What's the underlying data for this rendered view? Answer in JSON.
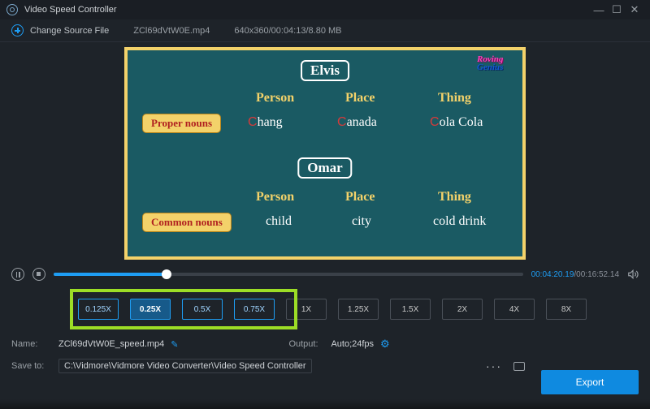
{
  "app": {
    "title": "Video Speed Controller"
  },
  "toolbar": {
    "change_source": "Change Source File",
    "filename": "ZCl69dVtW0E.mp4",
    "meta": "640x360/00:04:13/8.80 MB"
  },
  "preview": {
    "logo": {
      "line1": "Roving",
      "line2": "Genius"
    },
    "name1": "Elvis",
    "name2": "Omar",
    "headers": {
      "person": "Person",
      "place": "Place",
      "thing": "Thing"
    },
    "pill1": "Proper nouns",
    "pill2": "Common nouns",
    "row1": {
      "person": "Chang",
      "place": "Canada",
      "thing": "Cola Cola",
      "p_i": "C",
      "pl_i": "C",
      "t_i": "C"
    },
    "row2": {
      "person": "child",
      "place": "city",
      "thing": "cold drink"
    }
  },
  "transport": {
    "current": "00:04:20.19",
    "total": "00:16:52.14"
  },
  "speeds": [
    "0.125X",
    "0.25X",
    "0.5X",
    "0.75X",
    "1X",
    "1.25X",
    "1.5X",
    "2X",
    "4X",
    "8X"
  ],
  "speed_active_index": 1,
  "footer": {
    "name_label": "Name:",
    "name_value": "ZCl69dVtW0E_speed.mp4",
    "output_label": "Output:",
    "output_value": "Auto;24fps",
    "save_label": "Save to:",
    "save_value": "C:\\Vidmore\\Vidmore Video Converter\\Video Speed Controller",
    "export": "Export"
  }
}
